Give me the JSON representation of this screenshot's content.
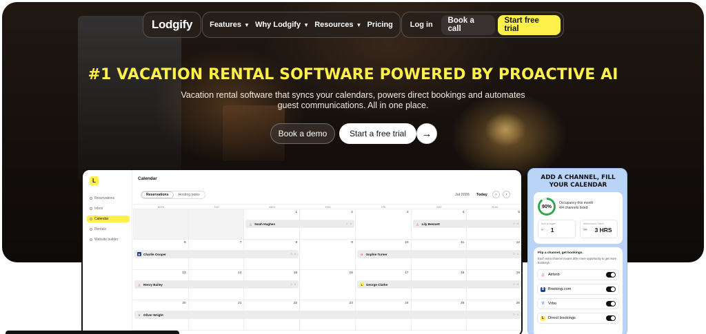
{
  "nav": {
    "logo": "Lodgify",
    "links": [
      {
        "label": "Features",
        "has_menu": true
      },
      {
        "label": "Why Lodgify",
        "has_menu": true
      },
      {
        "label": "Resources",
        "has_menu": true
      },
      {
        "label": "Pricing",
        "has_menu": false
      }
    ],
    "login": "Log in",
    "book_call": "Book a call",
    "trial": "Start free trial"
  },
  "hero": {
    "headline": "#1 VACATION RENTAL SOFTWARE POWERED BY PROACTIVE AI",
    "subline": "Vacation rental software that syncs your calendars, powers direct bookings and automates guest communications. All in one place.",
    "demo_button": "Book a demo",
    "free_button": "Start a free trial"
  },
  "app": {
    "title": "Calendar",
    "sidebar": [
      "Reservations",
      "Inbox",
      "Calendar",
      "Rentals",
      "Website builder"
    ],
    "active_sidebar": "Calendar",
    "tabs": [
      "Reservations",
      "Hosting tasks"
    ],
    "month": "Jul 2026",
    "today": "Today",
    "weekdays": [
      "MON",
      "TUE",
      "WED",
      "THU",
      "FRI",
      "SAT",
      "SUN"
    ],
    "weeks": [
      [
        "",
        "",
        "1",
        "2",
        "3",
        "4",
        "5"
      ],
      [
        "6",
        "7",
        "8",
        "9",
        "10",
        "11",
        "12"
      ],
      [
        "13",
        "14",
        "15",
        "16",
        "17",
        "18",
        "19"
      ],
      [
        "20",
        "21",
        "22",
        "23",
        "24",
        "25",
        "26"
      ]
    ],
    "bookings": [
      {
        "week": 0,
        "start": 2,
        "span": 2,
        "name": "Noah Hughes",
        "source": "airbnb",
        "meta": "2 · 4"
      },
      {
        "week": 0,
        "start": 5,
        "span": 2,
        "name": "Lily Bennett",
        "source": "airbnb",
        "meta": "2 · 4"
      },
      {
        "week": 1,
        "start": 0,
        "span": 3,
        "name": "Charlie Cooper",
        "source": "booking",
        "meta": "2 · 4"
      },
      {
        "week": 1,
        "start": 4,
        "span": 3,
        "name": "Sophie Turner",
        "source": "google",
        "meta": "2 · 4"
      },
      {
        "week": 2,
        "start": 0,
        "span": 3,
        "name": "Henry Bailey",
        "source": "airbnb",
        "meta": "2 · 4"
      },
      {
        "week": 2,
        "start": 4,
        "span": 3,
        "name": "George Clarke",
        "source": "lodgify",
        "meta": "2 · 4"
      },
      {
        "week": 3,
        "start": 0,
        "span": 7,
        "name": "Oliver Wright",
        "source": "vrbo",
        "meta": "2 · 4"
      }
    ]
  },
  "channel": {
    "title": "ADD A CHANNEL, FILL YOUR CALENDAR",
    "occupancy": "90%",
    "occupancy_fraction": 0.9,
    "occupancy_line1": "Occupancy this month",
    "occupancy_line2": "4/4 channels listed",
    "stat1_label": "New to toggle",
    "stat1_old": "0",
    "stat1_value": "1",
    "stat2_label": "Admin hours / week",
    "stat2_old": "20",
    "stat2_value": "3 HRS",
    "flip_title": "Flip a channel, get bookings.",
    "flip_desc": "Each extra channel means 30% more opportunity to get more bookings.",
    "channels": [
      {
        "name": "Airbnb",
        "icon": "airbnb-icon",
        "color": "#ff5a5f",
        "on": true
      },
      {
        "name": "Booking.com",
        "icon": "booking-icon",
        "color": "#1e3f8a",
        "on": true
      },
      {
        "name": "Vrbo",
        "icon": "vrbo-icon",
        "color": "#2c6fd6",
        "on": true
      },
      {
        "name": "Direct bookings",
        "icon": "direct-icon",
        "color": "#111111",
        "on": true
      }
    ]
  },
  "colors": {
    "accent": "#fdf04a",
    "channel_bg": "#b9d4f7",
    "ring": "#2fa84f"
  }
}
